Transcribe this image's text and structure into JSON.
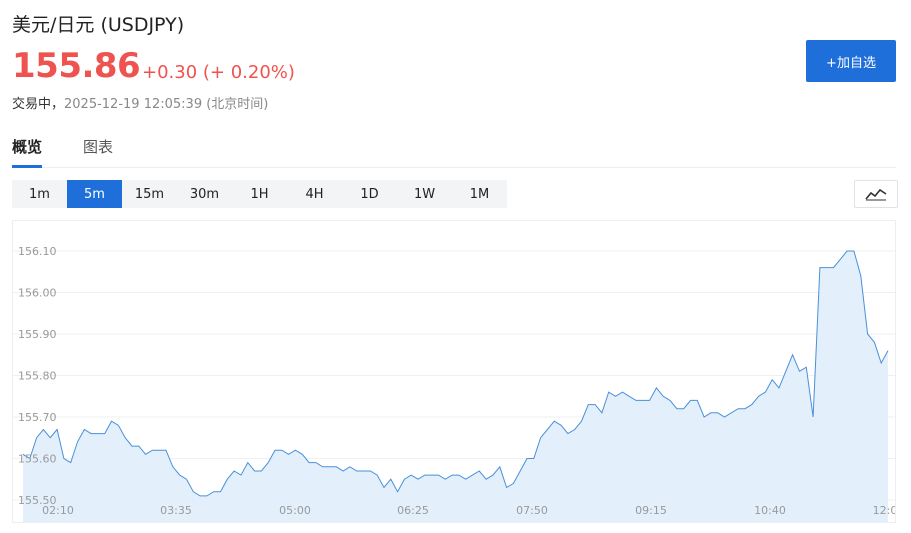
{
  "header": {
    "title": "美元/日元 (USDJPY)",
    "price": "155.86",
    "change": "+0.30 (+ 0.20%)",
    "status_state": "交易中，",
    "status_time": "2025-12-19 12:05:39 (北京时间)",
    "add_button": "+加自选"
  },
  "tabs": [
    {
      "label": "概览",
      "active": true
    },
    {
      "label": "图表",
      "active": false
    }
  ],
  "periods": [
    {
      "label": "1m",
      "active": false
    },
    {
      "label": "5m",
      "active": true
    },
    {
      "label": "15m",
      "active": false
    },
    {
      "label": "30m",
      "active": false
    },
    {
      "label": "1H",
      "active": false
    },
    {
      "label": "4H",
      "active": false
    },
    {
      "label": "1D",
      "active": false
    },
    {
      "label": "1W",
      "active": false
    },
    {
      "label": "1M",
      "active": false
    }
  ],
  "chart_type_icon": "line-chart-icon",
  "colors": {
    "accent": "#1e6fd9",
    "up": "#ef5350",
    "line": "#4a90d9",
    "fill": "#e3f0fc"
  },
  "chart_data": {
    "type": "area",
    "ylim": [
      155.5,
      156.15
    ],
    "y_ticks": [
      "155.50",
      "155.60",
      "155.70",
      "155.80",
      "155.90",
      "156.00",
      "156.10"
    ],
    "x_ticks": [
      "02:10",
      "03:35",
      "05:00",
      "06:25",
      "07:50",
      "09:15",
      "10:40",
      "12:0"
    ],
    "grid": true,
    "values": [
      155.61,
      155.6,
      155.65,
      155.67,
      155.65,
      155.67,
      155.6,
      155.59,
      155.64,
      155.67,
      155.66,
      155.66,
      155.66,
      155.69,
      155.68,
      155.65,
      155.63,
      155.63,
      155.61,
      155.62,
      155.62,
      155.62,
      155.58,
      155.56,
      155.55,
      155.52,
      155.51,
      155.51,
      155.52,
      155.52,
      155.55,
      155.57,
      155.56,
      155.59,
      155.57,
      155.57,
      155.59,
      155.62,
      155.62,
      155.61,
      155.62,
      155.61,
      155.59,
      155.59,
      155.58,
      155.58,
      155.58,
      155.57,
      155.58,
      155.57,
      155.57,
      155.57,
      155.56,
      155.53,
      155.55,
      155.52,
      155.55,
      155.56,
      155.55,
      155.56,
      155.56,
      155.56,
      155.55,
      155.56,
      155.56,
      155.55,
      155.56,
      155.57,
      155.55,
      155.56,
      155.58,
      155.53,
      155.54,
      155.57,
      155.6,
      155.6,
      155.65,
      155.67,
      155.69,
      155.68,
      155.66,
      155.67,
      155.69,
      155.73,
      155.73,
      155.71,
      155.76,
      155.75,
      155.76,
      155.75,
      155.74,
      155.74,
      155.74,
      155.77,
      155.75,
      155.74,
      155.72,
      155.72,
      155.74,
      155.74,
      155.7,
      155.71,
      155.71,
      155.7,
      155.71,
      155.72,
      155.72,
      155.73,
      155.75,
      155.76,
      155.79,
      155.77,
      155.81,
      155.85,
      155.81,
      155.82,
      155.7,
      156.06,
      156.06,
      156.06,
      156.08,
      156.1,
      156.1,
      156.04,
      155.9,
      155.88,
      155.83,
      155.86
    ]
  }
}
